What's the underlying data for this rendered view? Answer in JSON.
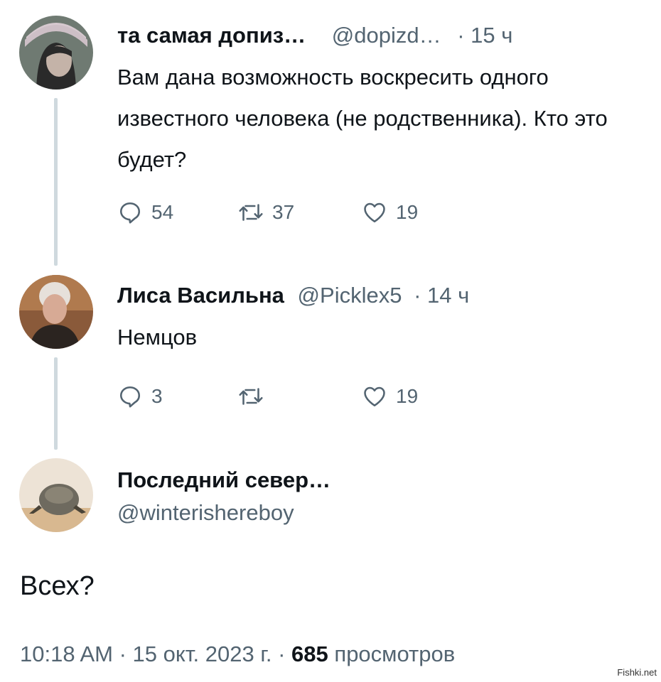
{
  "tweets": [
    {
      "name": "та самая допиз…",
      "handle": "@dopizd…",
      "time": "· 15 ч",
      "text": "Вам дана возможность воскресить одного известного человека (не родственника). Кто это будет?",
      "replies": "54",
      "retweets": "37",
      "likes": "19"
    },
    {
      "name": "Лиса Васильна",
      "handle": "@Picklex5",
      "time": "· 14 ч",
      "text": "Немцов",
      "replies": "3",
      "retweets": "",
      "likes": "19"
    }
  ],
  "main_tweet": {
    "name": "Последний север…",
    "handle": "@winterishereboy",
    "text": "Всех?",
    "timestamp": "10:18 AM · 15 окт. 2023 г. ·",
    "views_count": "685",
    "views_label": "просмотров"
  },
  "watermark": "Fishki.net",
  "colors": {
    "text": "#0f1419",
    "secondary": "#536471",
    "thread_line": "#cfd9de"
  },
  "icons": {
    "reply": "reply-icon",
    "retweet": "retweet-icon",
    "like": "heart-icon"
  }
}
